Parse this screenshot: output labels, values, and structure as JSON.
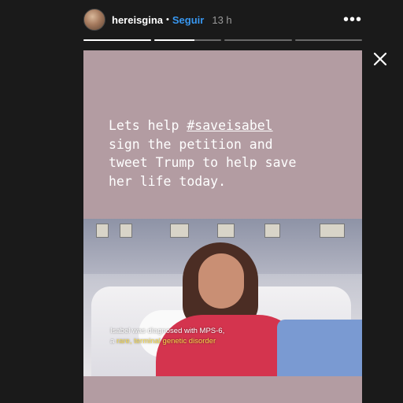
{
  "header": {
    "username": "hereisgina",
    "separator": "•",
    "follow_label": "Seguir",
    "timestamp": "13 h",
    "more_label": "•••"
  },
  "progress": [
    1.0,
    0.6,
    0.0,
    0.0
  ],
  "story": {
    "caption_line1": "Lets help ",
    "hashtag": "#saveisabel",
    "caption_rest": "sign the petition and\ntweet Trump to help save\nher life today.",
    "background_color": "#b39ca2"
  },
  "video": {
    "caption_line1": "Isabel was diagnosed with MPS-6,",
    "caption_line2_prefix": "a ",
    "caption_line2_highlight": "rare, terminal genetic disorder"
  },
  "icons": {
    "close": "close-icon",
    "more": "more-options-icon",
    "avatar": "avatar"
  }
}
